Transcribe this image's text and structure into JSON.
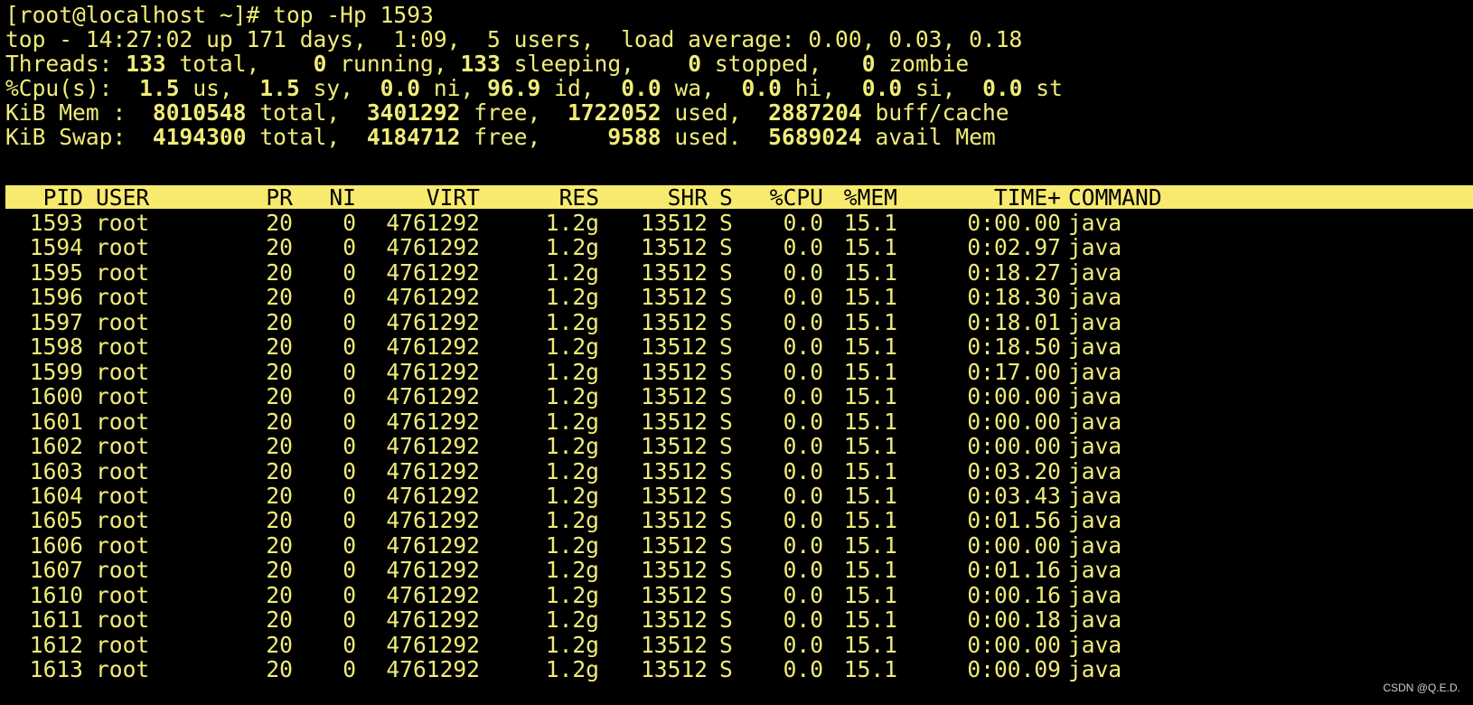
{
  "terminal": {
    "prompt_line": "[root@localhost ~]# top -Hp 1593",
    "summary": {
      "uptime_line": "top - 14:27:02 up 171 days,  1:09,  5 users,  load average: 0.00, 0.03, 0.18",
      "threads": {
        "label": "Threads:",
        "total": "133",
        "total_label": " total,",
        "running": "0",
        "running_label": " running,",
        "sleeping": "133",
        "sleeping_label": " sleeping,",
        "stopped": "0",
        "stopped_label": " stopped,",
        "zombie": "0",
        "zombie_label": " zombie"
      },
      "cpu": {
        "label": "%Cpu(s):",
        "us": "1.5",
        "us_label": " us,",
        "sy": "1.5",
        "sy_label": " sy,",
        "ni": "0.0",
        "ni_label": " ni,",
        "id": "96.9",
        "id_label": " id,",
        "wa": "0.0",
        "wa_label": " wa,",
        "hi": "0.0",
        "hi_label": " hi,",
        "si": "0.0",
        "si_label": " si,",
        "st": "0.0",
        "st_label": " st"
      },
      "mem": {
        "label": "KiB Mem :",
        "total": "8010548",
        "total_label": " total,",
        "free": "3401292",
        "free_label": " free,",
        "used": "1722052",
        "used_label": " used,",
        "buff": "2887204",
        "buff_label": " buff/cache"
      },
      "swap": {
        "label": "KiB Swap:",
        "total": "4194300",
        "total_label": " total,",
        "free": "4184712",
        "free_label": " free,",
        "used": "9588",
        "used_label": " used.",
        "avail": "5689024",
        "avail_label": " avail Mem"
      }
    },
    "columns": {
      "pid": "PID",
      "user": "USER",
      "pr": "PR",
      "ni": "NI",
      "virt": "VIRT",
      "res": "RES",
      "shr": "SHR",
      "s": "S",
      "cpu": "%CPU",
      "mem": "%MEM",
      "time": "TIME+",
      "command": "COMMAND"
    },
    "rows": [
      {
        "pid": "1593",
        "user": "root",
        "pr": "20",
        "ni": "0",
        "virt": "4761292",
        "res": "1.2g",
        "shr": "13512",
        "s": "S",
        "cpu": "0.0",
        "mem": "15.1",
        "time": "0:00.00",
        "command": "java"
      },
      {
        "pid": "1594",
        "user": "root",
        "pr": "20",
        "ni": "0",
        "virt": "4761292",
        "res": "1.2g",
        "shr": "13512",
        "s": "S",
        "cpu": "0.0",
        "mem": "15.1",
        "time": "0:02.97",
        "command": "java"
      },
      {
        "pid": "1595",
        "user": "root",
        "pr": "20",
        "ni": "0",
        "virt": "4761292",
        "res": "1.2g",
        "shr": "13512",
        "s": "S",
        "cpu": "0.0",
        "mem": "15.1",
        "time": "0:18.27",
        "command": "java"
      },
      {
        "pid": "1596",
        "user": "root",
        "pr": "20",
        "ni": "0",
        "virt": "4761292",
        "res": "1.2g",
        "shr": "13512",
        "s": "S",
        "cpu": "0.0",
        "mem": "15.1",
        "time": "0:18.30",
        "command": "java"
      },
      {
        "pid": "1597",
        "user": "root",
        "pr": "20",
        "ni": "0",
        "virt": "4761292",
        "res": "1.2g",
        "shr": "13512",
        "s": "S",
        "cpu": "0.0",
        "mem": "15.1",
        "time": "0:18.01",
        "command": "java"
      },
      {
        "pid": "1598",
        "user": "root",
        "pr": "20",
        "ni": "0",
        "virt": "4761292",
        "res": "1.2g",
        "shr": "13512",
        "s": "S",
        "cpu": "0.0",
        "mem": "15.1",
        "time": "0:18.50",
        "command": "java"
      },
      {
        "pid": "1599",
        "user": "root",
        "pr": "20",
        "ni": "0",
        "virt": "4761292",
        "res": "1.2g",
        "shr": "13512",
        "s": "S",
        "cpu": "0.0",
        "mem": "15.1",
        "time": "0:17.00",
        "command": "java"
      },
      {
        "pid": "1600",
        "user": "root",
        "pr": "20",
        "ni": "0",
        "virt": "4761292",
        "res": "1.2g",
        "shr": "13512",
        "s": "S",
        "cpu": "0.0",
        "mem": "15.1",
        "time": "0:00.00",
        "command": "java"
      },
      {
        "pid": "1601",
        "user": "root",
        "pr": "20",
        "ni": "0",
        "virt": "4761292",
        "res": "1.2g",
        "shr": "13512",
        "s": "S",
        "cpu": "0.0",
        "mem": "15.1",
        "time": "0:00.00",
        "command": "java"
      },
      {
        "pid": "1602",
        "user": "root",
        "pr": "20",
        "ni": "0",
        "virt": "4761292",
        "res": "1.2g",
        "shr": "13512",
        "s": "S",
        "cpu": "0.0",
        "mem": "15.1",
        "time": "0:00.00",
        "command": "java"
      },
      {
        "pid": "1603",
        "user": "root",
        "pr": "20",
        "ni": "0",
        "virt": "4761292",
        "res": "1.2g",
        "shr": "13512",
        "s": "S",
        "cpu": "0.0",
        "mem": "15.1",
        "time": "0:03.20",
        "command": "java"
      },
      {
        "pid": "1604",
        "user": "root",
        "pr": "20",
        "ni": "0",
        "virt": "4761292",
        "res": "1.2g",
        "shr": "13512",
        "s": "S",
        "cpu": "0.0",
        "mem": "15.1",
        "time": "0:03.43",
        "command": "java"
      },
      {
        "pid": "1605",
        "user": "root",
        "pr": "20",
        "ni": "0",
        "virt": "4761292",
        "res": "1.2g",
        "shr": "13512",
        "s": "S",
        "cpu": "0.0",
        "mem": "15.1",
        "time": "0:01.56",
        "command": "java"
      },
      {
        "pid": "1606",
        "user": "root",
        "pr": "20",
        "ni": "0",
        "virt": "4761292",
        "res": "1.2g",
        "shr": "13512",
        "s": "S",
        "cpu": "0.0",
        "mem": "15.1",
        "time": "0:00.00",
        "command": "java"
      },
      {
        "pid": "1607",
        "user": "root",
        "pr": "20",
        "ni": "0",
        "virt": "4761292",
        "res": "1.2g",
        "shr": "13512",
        "s": "S",
        "cpu": "0.0",
        "mem": "15.1",
        "time": "0:01.16",
        "command": "java"
      },
      {
        "pid": "1610",
        "user": "root",
        "pr": "20",
        "ni": "0",
        "virt": "4761292",
        "res": "1.2g",
        "shr": "13512",
        "s": "S",
        "cpu": "0.0",
        "mem": "15.1",
        "time": "0:00.16",
        "command": "java"
      },
      {
        "pid": "1611",
        "user": "root",
        "pr": "20",
        "ni": "0",
        "virt": "4761292",
        "res": "1.2g",
        "shr": "13512",
        "s": "S",
        "cpu": "0.0",
        "mem": "15.1",
        "time": "0:00.18",
        "command": "java"
      },
      {
        "pid": "1612",
        "user": "root",
        "pr": "20",
        "ni": "0",
        "virt": "4761292",
        "res": "1.2g",
        "shr": "13512",
        "s": "S",
        "cpu": "0.0",
        "mem": "15.1",
        "time": "0:00.00",
        "command": "java"
      },
      {
        "pid": "1613",
        "user": "root",
        "pr": "20",
        "ni": "0",
        "virt": "4761292",
        "res": "1.2g",
        "shr": "13512",
        "s": "S",
        "cpu": "0.0",
        "mem": "15.1",
        "time": "0:00.09",
        "command": "java"
      }
    ]
  },
  "watermark": "CSDN @Q.E.D.",
  "colors": {
    "background": "#000000",
    "text": "#f0ec78",
    "header_bar": "#f7ea6e",
    "header_text": "#000000"
  }
}
